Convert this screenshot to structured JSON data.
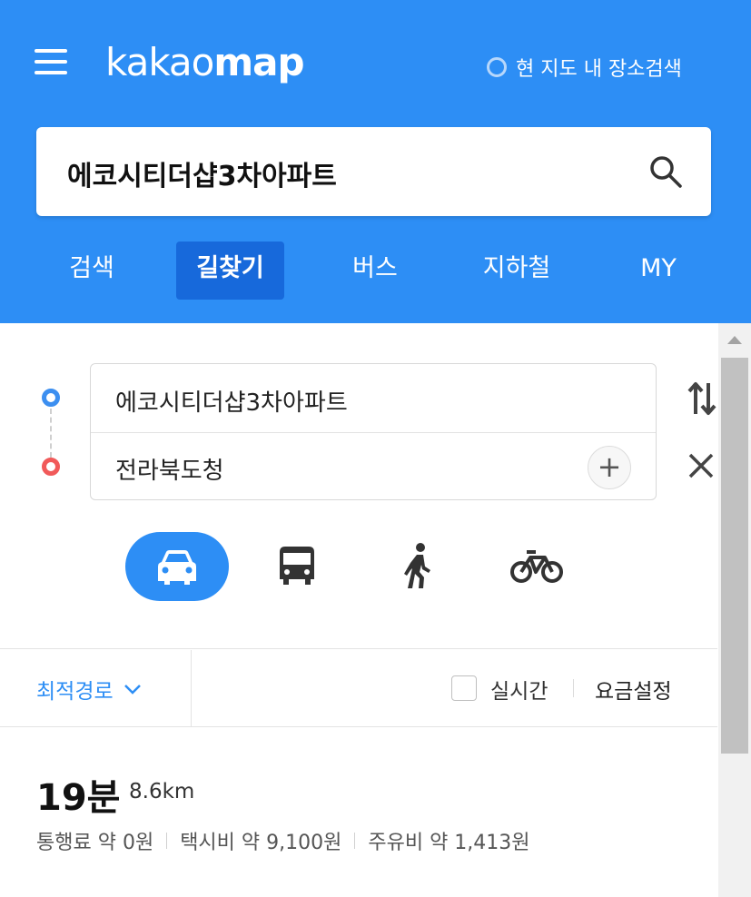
{
  "header": {
    "logo_light": "kakao",
    "logo_bold": "map",
    "area_search_label": "현 지도 내 장소검색",
    "search_query": "에코시티더샵3차아파트",
    "tabs": [
      {
        "label": "검색",
        "active": false
      },
      {
        "label": "길찾기",
        "active": true
      },
      {
        "label": "버스",
        "active": false
      },
      {
        "label": "지하철",
        "active": false
      },
      {
        "label": "MY",
        "active": false
      }
    ]
  },
  "route": {
    "origin": "에코시티더샵3차아파트",
    "destination": "전라북도청",
    "add_label": "+",
    "modes": [
      {
        "name": "car-icon",
        "active": true
      },
      {
        "name": "bus-icon",
        "active": false
      },
      {
        "name": "walk-icon",
        "active": false
      },
      {
        "name": "bike-icon",
        "active": false
      }
    ]
  },
  "options": {
    "best_route": "최적경로",
    "realtime": "실시간",
    "realtime_checked": false,
    "fee_setting": "요금설정"
  },
  "result": {
    "time": "19분",
    "distance": "8.6km",
    "toll": "통행료 약 0원",
    "taxi": "택시비 약 9,100원",
    "fuel": "주유비 약 1,413원"
  },
  "colors": {
    "brand_blue": "#2d8ef5",
    "active_tab": "#1769db",
    "origin_dot": "#3c8ff0",
    "destination_dot": "#f15a5a"
  }
}
